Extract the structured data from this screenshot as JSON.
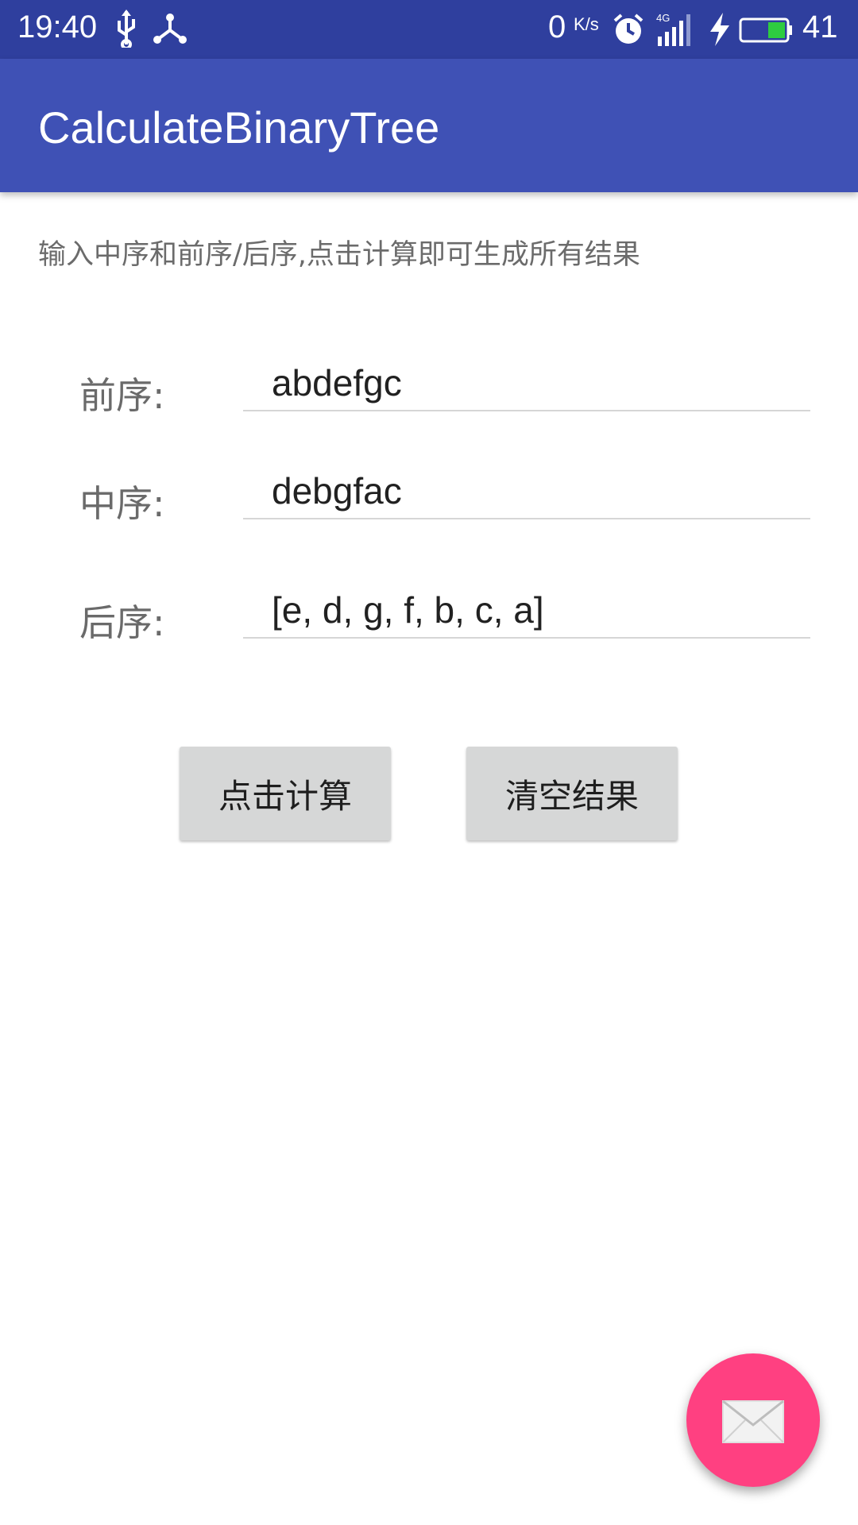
{
  "status_bar": {
    "time": "19:40",
    "net_speed": "0",
    "net_speed_unit": "K/s",
    "signal_type": "4G",
    "battery": "41",
    "icons": [
      "usb-icon",
      "share-icon",
      "alarm-icon",
      "signal-icon",
      "charge-icon",
      "battery-icon"
    ],
    "battery_color": "#2ecc40"
  },
  "app_bar": {
    "title": "CalculateBinaryTree",
    "color": "#3f51b5"
  },
  "hint": "输入中序和前序/后序,点击计算即可生成所有结果",
  "fields": {
    "preorder": {
      "label": "前序:",
      "value": "abdefgc"
    },
    "inorder": {
      "label": "中序:",
      "value": "debgfac"
    },
    "postorder": {
      "label": "后序:",
      "value": "[e, d, g, f, b, c, a]"
    }
  },
  "buttons": {
    "calculate": "点击计算",
    "clear": "清空结果"
  },
  "fab": {
    "icon": "mail-icon",
    "color": "#ff4081"
  }
}
